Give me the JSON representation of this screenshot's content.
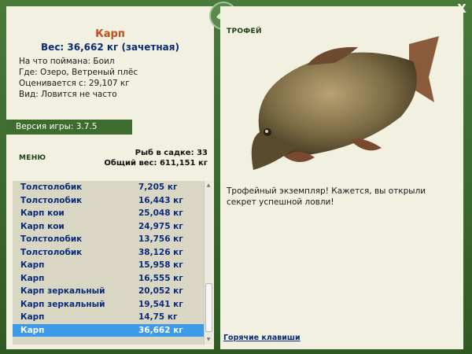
{
  "fish": {
    "name": "Карп",
    "weight": "Вес: 36,662 кг (зачетная)",
    "info": [
      "На что поймана: Боил",
      "Где: Озеро, Ветреный плёс",
      "Оценивается с: 29,107 кг",
      "Вид: Ловится не часто"
    ]
  },
  "version": "Версия игры: 3.7.5",
  "menu_label": "МЕНЮ",
  "cage": {
    "count": "Рыб в садке: 33",
    "total": "Общий вес: 611,151 кг"
  },
  "catch_list": [
    {
      "name": "Толстолобик",
      "weight": "7,205 кг"
    },
    {
      "name": "Толстолобик",
      "weight": "16,443 кг"
    },
    {
      "name": "Карп кои",
      "weight": "25,048 кг"
    },
    {
      "name": "Карп кои",
      "weight": "24,975 кг"
    },
    {
      "name": "Толстолобик",
      "weight": "13,756 кг"
    },
    {
      "name": "Толстолобик",
      "weight": "38,126 кг"
    },
    {
      "name": "Карп",
      "weight": "15,958 кг"
    },
    {
      "name": "Карп",
      "weight": "16,555 кг"
    },
    {
      "name": "Карп зеркальный",
      "weight": "20,052 кг"
    },
    {
      "name": "Карп зеркальный",
      "weight": "19,541 кг"
    },
    {
      "name": "Карп",
      "weight": "14,75 кг"
    },
    {
      "name": "Карп",
      "weight": "36,662 кг"
    }
  ],
  "selected_index": 11,
  "trophy": {
    "label": "ТРОФЕЙ",
    "text": "Трофейный экземпляр! Кажется, вы открыли секрет успешной ловли!"
  },
  "hotkeys_label": "Горячие клавиши",
  "close_label": "X",
  "colors": {
    "frame": "#3c6b2e",
    "panel": "#f2f0e1",
    "list_bg": "#d9d7c3",
    "selected": "#3d9ae8",
    "fish_name": "#c0501a",
    "text_blue": "#0b2b7a"
  }
}
